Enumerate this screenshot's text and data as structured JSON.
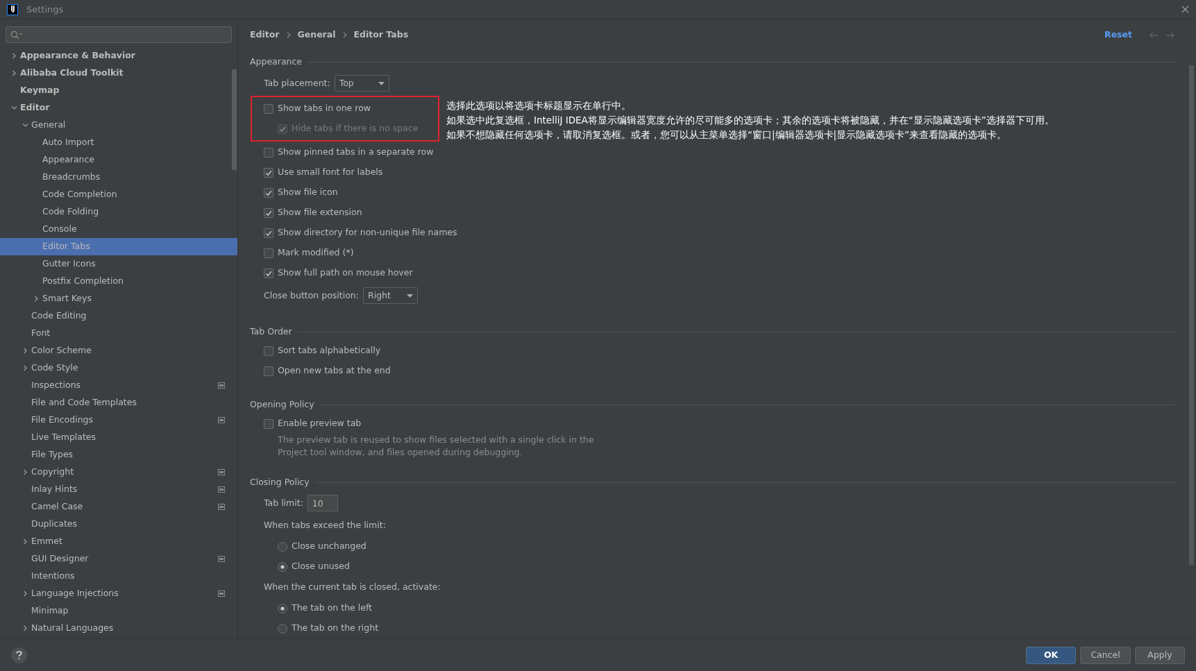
{
  "window": {
    "logo": "IJ",
    "title": "Settings"
  },
  "sidebar": {
    "items": [
      {
        "label": "Appearance & Behavior",
        "expanded": false,
        "scope_icon": false
      },
      {
        "label": "Alibaba Cloud Toolkit",
        "expanded": false,
        "scope_icon": false
      },
      {
        "label": "Keymap",
        "scope_icon": false
      },
      {
        "label": "Editor",
        "expanded": true,
        "scope_icon": false,
        "children": [
          {
            "label": "General",
            "expanded": true,
            "scope_icon": false,
            "children": [
              {
                "label": "Auto Import",
                "selected": false,
                "scope_icon": false
              },
              {
                "label": "Appearance",
                "selected": false,
                "scope_icon": false
              },
              {
                "label": "Breadcrumbs",
                "selected": false,
                "scope_icon": false
              },
              {
                "label": "Code Completion",
                "selected": false,
                "scope_icon": false
              },
              {
                "label": "Code Folding",
                "selected": false,
                "scope_icon": false
              },
              {
                "label": "Console",
                "selected": false,
                "scope_icon": false
              },
              {
                "label": "Editor Tabs",
                "selected": true,
                "scope_icon": false
              },
              {
                "label": "Gutter Icons",
                "selected": false,
                "scope_icon": false
              },
              {
                "label": "Postfix Completion",
                "selected": false,
                "scope_icon": false
              },
              {
                "label": "Smart Keys",
                "expanded": false,
                "selected": false,
                "scope_icon": false
              }
            ]
          },
          {
            "label": "Code Editing",
            "selected": false,
            "scope_icon": false
          },
          {
            "label": "Font",
            "selected": false,
            "scope_icon": false
          },
          {
            "label": "Color Scheme",
            "expanded": false,
            "selected": false,
            "scope_icon": false
          },
          {
            "label": "Code Style",
            "expanded": false,
            "selected": false,
            "scope_icon": false
          },
          {
            "label": "Inspections",
            "selected": false,
            "scope_icon": true
          },
          {
            "label": "File and Code Templates",
            "selected": false,
            "scope_icon": false
          },
          {
            "label": "File Encodings",
            "selected": false,
            "scope_icon": true
          },
          {
            "label": "Live Templates",
            "selected": false,
            "scope_icon": false
          },
          {
            "label": "File Types",
            "selected": false,
            "scope_icon": false
          },
          {
            "label": "Copyright",
            "expanded": false,
            "selected": false,
            "scope_icon": true
          },
          {
            "label": "Inlay Hints",
            "selected": false,
            "scope_icon": true
          },
          {
            "label": "Camel Case",
            "selected": false,
            "scope_icon": true
          },
          {
            "label": "Duplicates",
            "selected": false,
            "scope_icon": false
          },
          {
            "label": "Emmet",
            "expanded": false,
            "selected": false,
            "scope_icon": false
          },
          {
            "label": "GUI Designer",
            "selected": false,
            "scope_icon": true
          },
          {
            "label": "Intentions",
            "selected": false,
            "scope_icon": false
          },
          {
            "label": "Language Injections",
            "expanded": false,
            "selected": false,
            "scope_icon": true
          },
          {
            "label": "Minimap",
            "selected": false,
            "scope_icon": false
          },
          {
            "label": "Natural Languages",
            "expanded": false,
            "selected": false,
            "scope_icon": false
          }
        ]
      }
    ]
  },
  "breadcrumb": [
    "Editor",
    "General",
    "Editor Tabs"
  ],
  "reset": "Reset",
  "sections": [
    {
      "title": "Appearance",
      "rows": [
        {
          "kind": "dropdown",
          "label": "Tab placement:",
          "value": "Top"
        },
        {
          "kind": "checkbox",
          "label": "Show tabs in one row",
          "checked": false,
          "disabled": false,
          "highlighted": true,
          "children": [
            {
              "kind": "checkbox",
              "label": "Hide tabs if there is no space",
              "checked": true,
              "disabled": true
            }
          ],
          "annotation": [
            "选择此选项以将选项卡标题显示在单行中。",
            "如果选中此复选框，IntelliJ IDEA将显示编辑器宽度允许的尽可能多的选项卡；其余的选项卡将被隐藏，并在“显示隐藏选项卡”选择器下可用。",
            "如果不想隐藏任何选项卡，请取消复选框。或者，您可以从主菜单选择“窗口|编辑器选项卡|显示隐藏选项卡”来查看隐藏的选项卡。"
          ]
        },
        {
          "kind": "checkbox",
          "label": "Show pinned tabs in a separate row",
          "checked": false,
          "disabled": false
        },
        {
          "kind": "checkbox",
          "label": "Use small font for labels",
          "checked": true,
          "disabled": false
        },
        {
          "kind": "checkbox",
          "label": "Show file icon",
          "checked": true,
          "disabled": false
        },
        {
          "kind": "checkbox",
          "label": "Show file extension",
          "checked": true,
          "disabled": false
        },
        {
          "kind": "checkbox",
          "label": "Show directory for non-unique file names",
          "checked": true,
          "disabled": false
        },
        {
          "kind": "checkbox",
          "label": "Mark modified (*)",
          "checked": false,
          "disabled": false
        },
        {
          "kind": "checkbox",
          "label": "Show full path on mouse hover",
          "checked": true,
          "disabled": false
        },
        {
          "kind": "dropdown",
          "label": "Close button position:",
          "value": "Right"
        }
      ]
    },
    {
      "title": "Tab Order",
      "rows": [
        {
          "kind": "checkbox",
          "label": "Sort tabs alphabetically",
          "checked": false,
          "disabled": false
        },
        {
          "kind": "checkbox",
          "label": "Open new tabs at the end",
          "checked": false,
          "disabled": false
        }
      ]
    },
    {
      "title": "Opening Policy",
      "rows": [
        {
          "kind": "checkbox",
          "label": "Enable preview tab",
          "checked": false,
          "disabled": false,
          "description": "The preview tab is reused to show files selected with a single click in the Project tool window, and files opened during debugging."
        }
      ]
    },
    {
      "title": "Closing Policy",
      "rows": [
        {
          "kind": "text_input",
          "label": "Tab limit:",
          "value": "10"
        },
        {
          "kind": "radio_group",
          "label": "When tabs exceed the limit:",
          "options": [
            {
              "label": "Close unchanged",
              "selected": false
            },
            {
              "label": "Close unused",
              "selected": true
            }
          ]
        },
        {
          "kind": "radio_group",
          "label": "When the current tab is closed, activate:",
          "options": [
            {
              "label": "The tab on the left",
              "selected": true
            },
            {
              "label": "The tab on the right",
              "selected": false
            }
          ]
        }
      ]
    }
  ],
  "buttons": [
    {
      "label": "OK",
      "default": true
    },
    {
      "label": "Cancel",
      "default": false
    },
    {
      "label": "Apply",
      "default": false
    }
  ]
}
